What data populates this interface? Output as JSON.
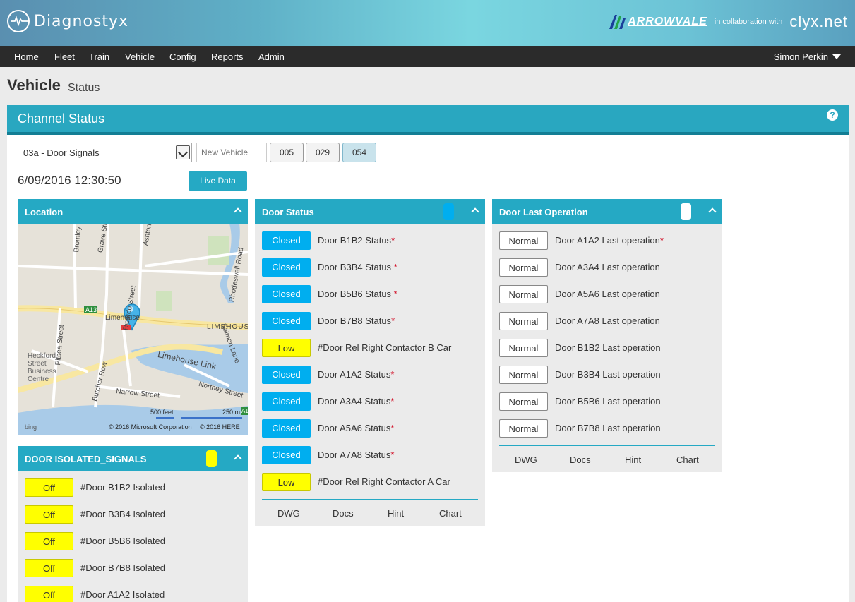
{
  "header": {
    "logo_text": "Diagnostyx",
    "partner": "ARROWVALE",
    "collab_text": "in collaboration with",
    "clyx": "clyx.net"
  },
  "nav": {
    "items": [
      "Home",
      "Fleet",
      "Train",
      "Vehicle",
      "Config",
      "Reports",
      "Admin"
    ],
    "user": "Simon Perkin"
  },
  "page": {
    "title": "Vehicle",
    "subtitle": "Status"
  },
  "channel": {
    "title": "Channel Status",
    "help": "?",
    "select_value": "03a - Door Signals",
    "new_vehicle_placeholder": "New Vehicle",
    "vehicles": [
      "005",
      "029",
      "054"
    ],
    "active_vehicle": "054",
    "datetime": "6/09/2016 12:30:50",
    "live_button": "Live Data"
  },
  "location": {
    "title": "Location",
    "map_labels": [
      "Bromley Street",
      "Grave Street",
      "Ashton Street",
      "Ricardo Street",
      "Rhodeswell Road",
      "Salmon Lane",
      "A13",
      "Limehouse",
      "LIMEHOUSE",
      "Pitsea Street",
      "Butcher Row",
      "Heckford Street Business Centre",
      "Limehouse Link",
      "Narrow Street",
      "Northey Street",
      "A13"
    ],
    "scale_feet": "500 feet",
    "scale_m": "250 m",
    "copyright_ms": "© 2016 Microsoft Corporation",
    "copyright_here": "© 2016 HERE",
    "bing": "bing"
  },
  "door_status": {
    "title": "Door Status",
    "indicator_color": "#00aeef",
    "rows": [
      {
        "state": "Closed",
        "kind": "closed",
        "label": "Door B1B2 Status",
        "ast": "*"
      },
      {
        "state": "Closed",
        "kind": "closed",
        "label": "Door B3B4 Status ",
        "ast": "*"
      },
      {
        "state": "Closed",
        "kind": "closed",
        "label": "Door B5B6 Status ",
        "ast": "*"
      },
      {
        "state": "Closed",
        "kind": "closed",
        "label": "Door B7B8 Status",
        "ast": "*"
      },
      {
        "state": "Low",
        "kind": "low",
        "label": "#Door Rel Right Contactor B Car",
        "ast": ""
      },
      {
        "state": "Closed",
        "kind": "closed",
        "label": "Door A1A2 Status",
        "ast": "*"
      },
      {
        "state": "Closed",
        "kind": "closed",
        "label": "Door A3A4 Status",
        "ast": "*"
      },
      {
        "state": "Closed",
        "kind": "closed",
        "label": "Door A5A6 Status",
        "ast": "*"
      },
      {
        "state": "Closed",
        "kind": "closed",
        "label": "Door A7A8 Status",
        "ast": "*"
      },
      {
        "state": "Low",
        "kind": "low",
        "label": "#Door Rel Right Contactor A Car",
        "ast": ""
      }
    ],
    "footer": [
      "DWG",
      "Docs",
      "Hint",
      "Chart"
    ]
  },
  "door_last_op": {
    "title": "Door Last Operation",
    "indicator_color": "#ffffff",
    "rows": [
      {
        "state": "Normal",
        "kind": "normal",
        "label": "Door A1A2 Last operation",
        "ast": "*"
      },
      {
        "state": "Normal",
        "kind": "normal",
        "label": "Door A3A4 Last operation",
        "ast": ""
      },
      {
        "state": "Normal",
        "kind": "normal",
        "label": "Door A5A6 Last operation",
        "ast": ""
      },
      {
        "state": "Normal",
        "kind": "normal",
        "label": "Door A7A8 Last operation",
        "ast": ""
      },
      {
        "state": "Normal",
        "kind": "normal",
        "label": "Door B1B2 Last operation",
        "ast": ""
      },
      {
        "state": "Normal",
        "kind": "normal",
        "label": "Door B3B4 Last operation",
        "ast": ""
      },
      {
        "state": "Normal",
        "kind": "normal",
        "label": "Door B5B6 Last operation",
        "ast": ""
      },
      {
        "state": "Normal",
        "kind": "normal",
        "label": "Door B7B8 Last operation",
        "ast": ""
      }
    ],
    "footer": [
      "DWG",
      "Docs",
      "Hint",
      "Chart"
    ]
  },
  "door_isolated": {
    "title": "DOOR ISOLATED_SIGNALS",
    "indicator_color": "#ffff00",
    "rows": [
      {
        "state": "Off",
        "kind": "off",
        "label": "#Door B1B2 Isolated",
        "ast": ""
      },
      {
        "state": "Off",
        "kind": "off",
        "label": "#Door B3B4 Isolated",
        "ast": ""
      },
      {
        "state": "Off",
        "kind": "off",
        "label": "#Door B5B6 Isolated",
        "ast": ""
      },
      {
        "state": "Off",
        "kind": "off",
        "label": "#Door B7B8 Isolated",
        "ast": ""
      },
      {
        "state": "Off",
        "kind": "off",
        "label": "#Door A1A2 Isolated",
        "ast": ""
      }
    ]
  }
}
